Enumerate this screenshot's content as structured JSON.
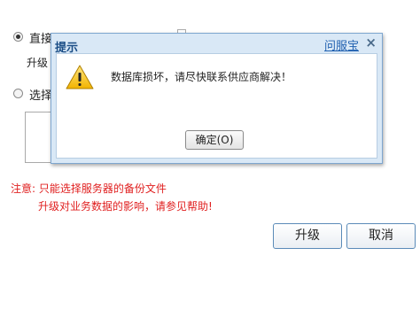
{
  "background": {
    "option_direct_label": "直接",
    "upgrade_label": "升级",
    "option_select_label": "选择",
    "note_line1": "注意: 只能选择服务器的备份文件",
    "note_line2": "升级对业务数据的影响，请参见帮助!"
  },
  "buttons": {
    "upgrade": "升级",
    "cancel": "取消"
  },
  "dialog": {
    "title": "提示",
    "help_link": "问服宝",
    "close_glyph": "×",
    "message": "数据库损坏，请尽快联系供应商解决！",
    "ok_label": "确定(O)",
    "icon": "warning-icon"
  },
  "colors": {
    "note_red": "#e02020",
    "dialog_title": "#1a4d86",
    "dialog_frame": "#7ea6cf"
  }
}
